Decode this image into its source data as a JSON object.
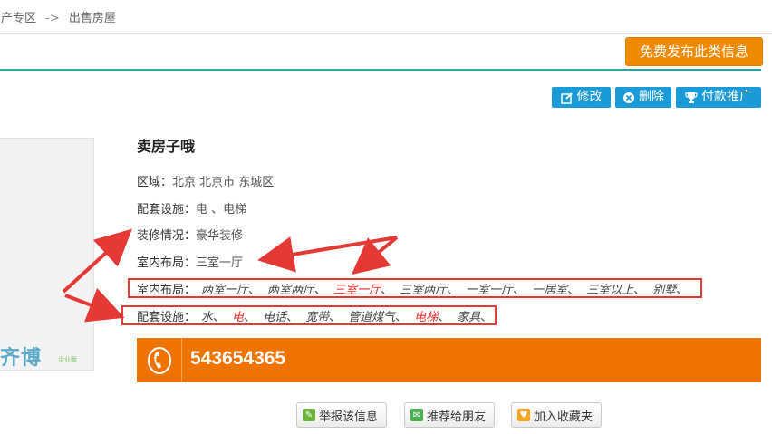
{
  "breadcrumb": {
    "prev": "房产专区",
    "sep": "->",
    "current": "出售房屋"
  },
  "publish_button": "免费发布此类信息",
  "actions": {
    "edit": "修改",
    "delete": "删除",
    "promote": "付款推广"
  },
  "image_logo": {
    "text": "齐博",
    "sub": "企业版"
  },
  "listing": {
    "title": "卖房子哦",
    "region_label": "区域：",
    "region_value": "北京 北京市 东城区",
    "facility_label": "配套设施：",
    "facility_value": "电 、电梯",
    "decor_label": "装修情况：",
    "decor_value": "豪华装修",
    "layout_label": "室内布局：",
    "layout_value": "三室一厅"
  },
  "layout_options": {
    "label": "室内布局：",
    "items": [
      "两室一厅",
      "两室两厅",
      "三室一厅",
      "三室两厅",
      "一室一厅",
      "一居室",
      "三室以上",
      "别墅"
    ],
    "selected": "三室一厅"
  },
  "facility_options": {
    "label": "配套设施：",
    "items": [
      "水",
      "电",
      "电话",
      "宽带",
      "管道煤气",
      "电梯",
      "家具"
    ],
    "selected": [
      "电",
      "电梯"
    ]
  },
  "phone": "543654365",
  "bottom_buttons": {
    "report": "举报该信息",
    "share": "推荐给朋友",
    "favorite": "加入收藏夹"
  },
  "colors": {
    "accent_orange": "#ef7300",
    "action_blue": "#1a9bd7",
    "teal": "#2aa79a",
    "highlight_red": "#e53935"
  }
}
